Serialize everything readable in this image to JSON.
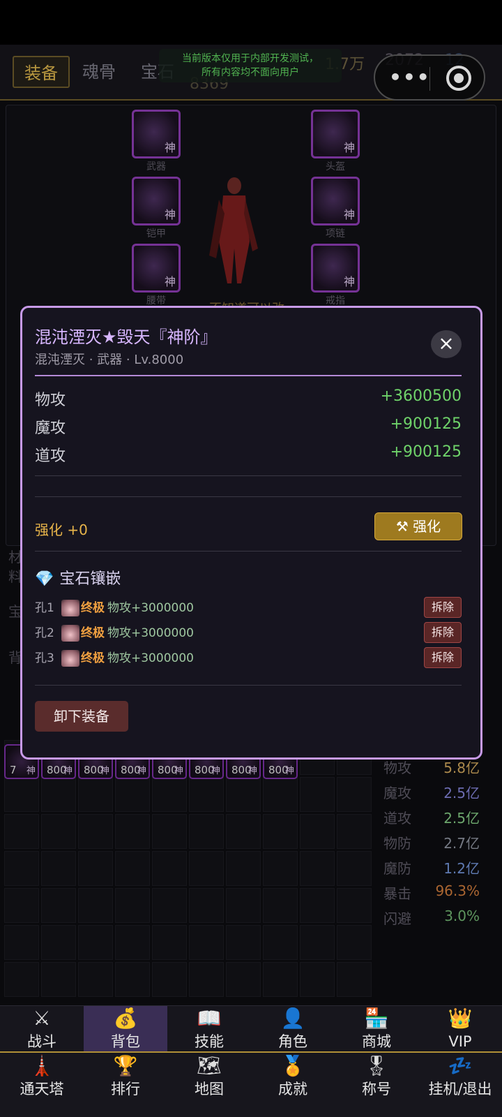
{
  "top": {
    "tabs": [
      "装备",
      "魂骨",
      "宝石"
    ],
    "notice": [
      "当前版本仅用于内部开发测试，",
      "所有内容均不面向用户"
    ],
    "resources": [
      "1.7万",
      "2072",
      "12",
      "8369"
    ]
  },
  "equip": {
    "slots": [
      {
        "label": "武器",
        "tier": "神"
      },
      {
        "label": "头盔",
        "tier": "神"
      },
      {
        "label": "铠甲",
        "tier": "神"
      },
      {
        "label": "项链",
        "tier": "神"
      },
      {
        "label": "腰带",
        "tier": "神"
      },
      {
        "label": "戒指",
        "tier": "神"
      }
    ],
    "hero_name": "不知道可以改"
  },
  "modal": {
    "title": "混沌湮灭★毁天『神阶』",
    "subtitle": "混沌湮灭 · 武器 · Lv.8000",
    "close_icon": "×",
    "attrs": [
      {
        "k": "物攻",
        "v": "+3600500"
      },
      {
        "k": "魔攻",
        "v": "+900125"
      },
      {
        "k": "道攻",
        "v": "+900125"
      }
    ],
    "enhance_label": "强化 +0",
    "enhance_button": "⚒ 强化",
    "gem_section": "宝石镶嵌",
    "gem_icon": "💎",
    "holes": [
      {
        "k": "孔1",
        "tier": "终极",
        "value": "物攻+3000000",
        "remove": "拆除"
      },
      {
        "k": "孔2",
        "tier": "终极",
        "value": "物攻+3000000",
        "remove": "拆除"
      },
      {
        "k": "孔3",
        "tier": "终极",
        "value": "物攻+3000000",
        "remove": "拆除"
      }
    ],
    "unequip": "卸下装备"
  },
  "inventory": {
    "items": [
      {
        "lv": "7",
        "tier": "神"
      },
      {
        "lv": "800",
        "tier": "神"
      },
      {
        "lv": "800",
        "tier": "神"
      },
      {
        "lv": "800",
        "tier": "神"
      },
      {
        "lv": "800",
        "tier": "神"
      },
      {
        "lv": "800",
        "tier": "神"
      },
      {
        "lv": "800",
        "tier": "神"
      },
      {
        "lv": "800",
        "tier": "神"
      }
    ]
  },
  "stats": [
    {
      "k": "物攻",
      "v": "5.8亿",
      "color": "#c9a25a"
    },
    {
      "k": "魔攻",
      "v": "2.5亿",
      "color": "#7f7fd0"
    },
    {
      "k": "道攻",
      "v": "2.5亿",
      "color": "#7fc37f"
    },
    {
      "k": "物防",
      "v": "2.7亿",
      "color": "#8a8f9a"
    },
    {
      "k": "魔防",
      "v": "1.2亿",
      "color": "#6f8fd0"
    },
    {
      "k": "暴击",
      "v": "96.3%",
      "color": "#c9783a"
    },
    {
      "k": "闪避",
      "v": "3.0%",
      "color": "#6fb06f"
    }
  ],
  "nav": [
    {
      "label": "战斗",
      "icon": "⚔"
    },
    {
      "label": "背包",
      "icon": "💰"
    },
    {
      "label": "技能",
      "icon": "📖"
    },
    {
      "label": "角色",
      "icon": "👤"
    },
    {
      "label": "商城",
      "icon": "🏪"
    },
    {
      "label": "VIP",
      "icon": "👑"
    },
    {
      "label": "通天塔",
      "icon": "🗼"
    },
    {
      "label": "排行",
      "icon": "🏆"
    },
    {
      "label": "地图",
      "icon": "🗺"
    },
    {
      "label": "成就",
      "icon": "🏅"
    },
    {
      "label": "称号",
      "icon": "🎖"
    },
    {
      "label": "挂机/退出",
      "icon": "💤"
    }
  ]
}
